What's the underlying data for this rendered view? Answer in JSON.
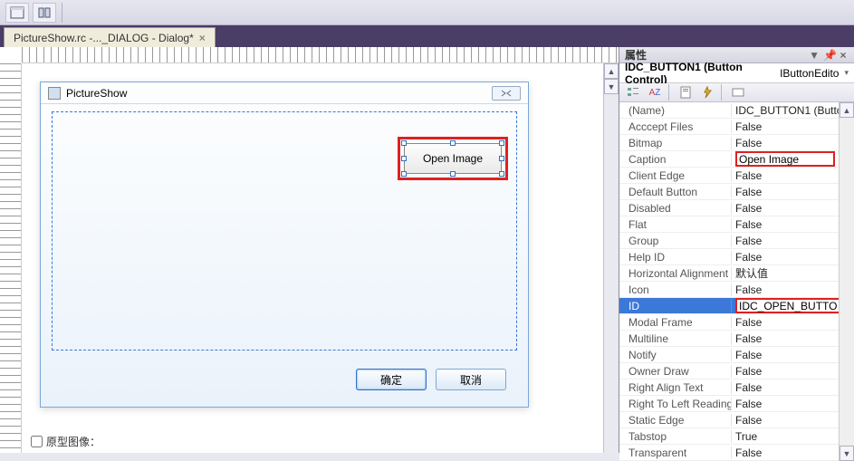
{
  "toolbar": {
    "layout_icon": "layout",
    "tool2_icon": "tool"
  },
  "tab": {
    "label": "PictureShow.rc -..._DIALOG - Dialog*",
    "close": "×"
  },
  "dialog": {
    "title": "PictureShow",
    "open_image_label": "Open Image",
    "ok_label": "确定",
    "cancel_label": "取消"
  },
  "bottom": {
    "checkbox_label": "原型图像："
  },
  "properties": {
    "panel_title": "属性",
    "object_line_bold": "IDC_BUTTON1 (Button Control)",
    "object_line_rest": "IButtonEdito",
    "rows": [
      {
        "name": "(Name)",
        "value": "IDC_BUTTON1 (Butto"
      },
      {
        "name": "Acccept Files",
        "value": "False"
      },
      {
        "name": "Bitmap",
        "value": "False"
      },
      {
        "name": "Caption",
        "value": "Open Image",
        "highlight": "caption"
      },
      {
        "name": "Client Edge",
        "value": "False"
      },
      {
        "name": "Default Button",
        "value": "False"
      },
      {
        "name": "Disabled",
        "value": "False"
      },
      {
        "name": "Flat",
        "value": "False"
      },
      {
        "name": "Group",
        "value": "False"
      },
      {
        "name": "Help ID",
        "value": "False"
      },
      {
        "name": "Horizontal Alignment",
        "value": "默认值"
      },
      {
        "name": "Icon",
        "value": "False"
      },
      {
        "name": "ID",
        "value": "IDC_OPEN_BUTTO",
        "selected": true,
        "highlight": "id"
      },
      {
        "name": "Modal Frame",
        "value": "False"
      },
      {
        "name": "Multiline",
        "value": "False"
      },
      {
        "name": "Notify",
        "value": "False"
      },
      {
        "name": "Owner Draw",
        "value": "False"
      },
      {
        "name": "Right Align Text",
        "value": "False"
      },
      {
        "name": "Right To Left Reading",
        "value": "False"
      },
      {
        "name": "Static Edge",
        "value": "False"
      },
      {
        "name": "Tabstop",
        "value": "True"
      },
      {
        "name": "Transparent",
        "value": "False"
      }
    ]
  }
}
